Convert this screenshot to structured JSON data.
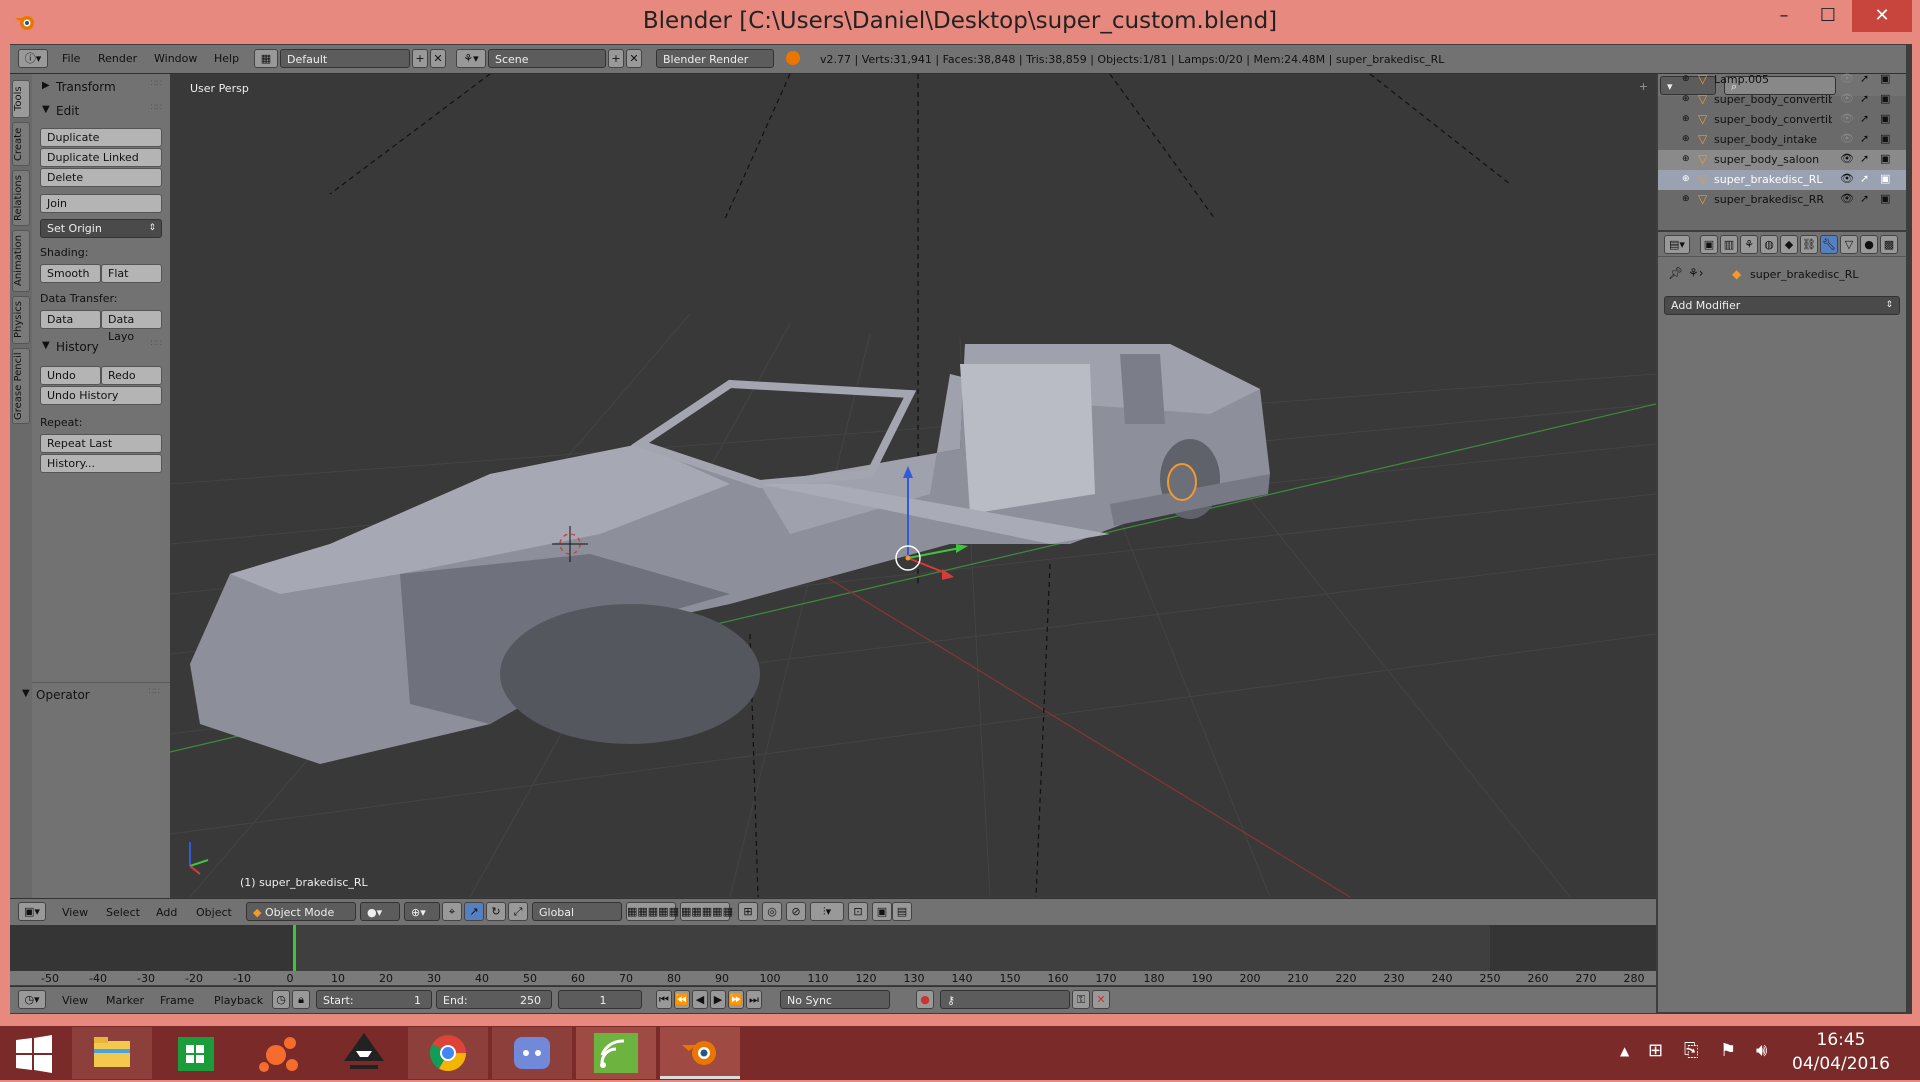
{
  "window": {
    "title": "Blender [C:\\Users\\Daniel\\Desktop\\super_custom.blend]",
    "controls": [
      "–",
      "☐",
      "✕"
    ]
  },
  "infobar": {
    "menus": [
      "File",
      "Render",
      "Window",
      "Help"
    ],
    "screen_layout": "Default",
    "scene": "Scene",
    "render_engine": "Blender Render",
    "stats": "v2.77 | Verts:31,941 | Faces:38,848 | Tris:38,859 | Objects:1/81 | Lamps:0/20 | Mem:24.48M | super_brakedisc_RL"
  },
  "shelf_tabs": [
    "Tools",
    "Create",
    "Relations",
    "Animation",
    "Physics",
    "Grease Pencil"
  ],
  "shelf": {
    "transform": "Transform",
    "edit": "Edit",
    "duplicate": "Duplicate",
    "duplicate_linked": "Duplicate Linked",
    "delete": "Delete",
    "join": "Join",
    "set_origin": "Set Origin",
    "shading_label": "Shading:",
    "smooth": "Smooth",
    "flat": "Flat",
    "data_transfer_label": "Data Transfer:",
    "data": "Data",
    "data_layout": "Data Layo",
    "history": "History",
    "undo": "Undo",
    "redo": "Redo",
    "undo_history": "Undo History",
    "repeat_label": "Repeat:",
    "repeat_last": "Repeat Last",
    "history_menu": "History...",
    "operator": "Operator"
  },
  "viewport": {
    "view_label": "User Persp",
    "active_object": "(1) super_brakedisc_RL"
  },
  "viewport_header": {
    "menus": [
      "View",
      "Select",
      "Add",
      "Object"
    ],
    "mode": "Object Mode",
    "orientation": "Global"
  },
  "timeline": {
    "ticks": [
      "-50",
      "-40",
      "-30",
      "-20",
      "-10",
      "0",
      "10",
      "20",
      "30",
      "40",
      "50",
      "60",
      "70",
      "80",
      "90",
      "100",
      "110",
      "120",
      "130",
      "140",
      "150",
      "160",
      "170",
      "180",
      "190",
      "200",
      "210",
      "220",
      "230",
      "240",
      "250",
      "260",
      "270",
      "280"
    ],
    "menus": [
      "View",
      "Marker",
      "Frame",
      "Playback"
    ],
    "start_label": "Start:",
    "start_value": "1",
    "end_label": "End:",
    "end_value": "250",
    "current_frame": "1",
    "sync": "No Sync"
  },
  "outliner": {
    "items": [
      {
        "name": "Lamp.005",
        "visible": false
      },
      {
        "name": "super_body_convertible",
        "visible": false
      },
      {
        "name": "super_body_convertible",
        "visible": false
      },
      {
        "name": "super_body_intake",
        "visible": false
      },
      {
        "name": "super_body_saloon",
        "visible": true
      },
      {
        "name": "super_brakedisc_RL",
        "visible": true
      },
      {
        "name": "super_brakedisc_RR",
        "visible": true
      }
    ]
  },
  "properties": {
    "object_name": "super_brakedisc_RL",
    "add_modifier": "Add Modifier"
  },
  "taskbar": {
    "time": "16:45",
    "date": "04/04/2016"
  },
  "colors": {
    "titlebar": "#e8897f",
    "panel": "#727272",
    "viewport_bg": "#393939",
    "taskbar": "#7a2a28",
    "selection_orange": "#f29a2e",
    "axis_x": "#d83a3a",
    "axis_y": "#3fc43f",
    "axis_z": "#2f5cd6"
  }
}
